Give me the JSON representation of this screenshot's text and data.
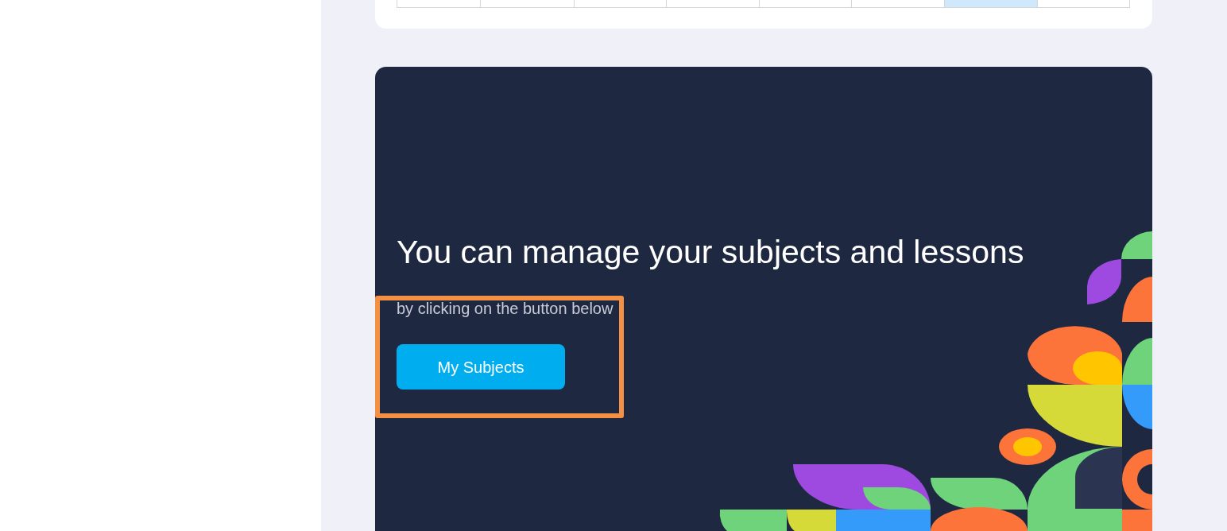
{
  "calendar": {
    "cells": [
      {
        "selected": false
      },
      {
        "selected": false
      },
      {
        "selected": false
      },
      {
        "selected": false
      },
      {
        "selected": false
      },
      {
        "selected": false
      },
      {
        "selected": true
      },
      {
        "selected": false
      }
    ]
  },
  "banner": {
    "title": "You can manage your subjects and lessons",
    "subtitle": "by clicking on the button below",
    "button": {
      "label": "My Subjects",
      "highlighted": true
    }
  }
}
